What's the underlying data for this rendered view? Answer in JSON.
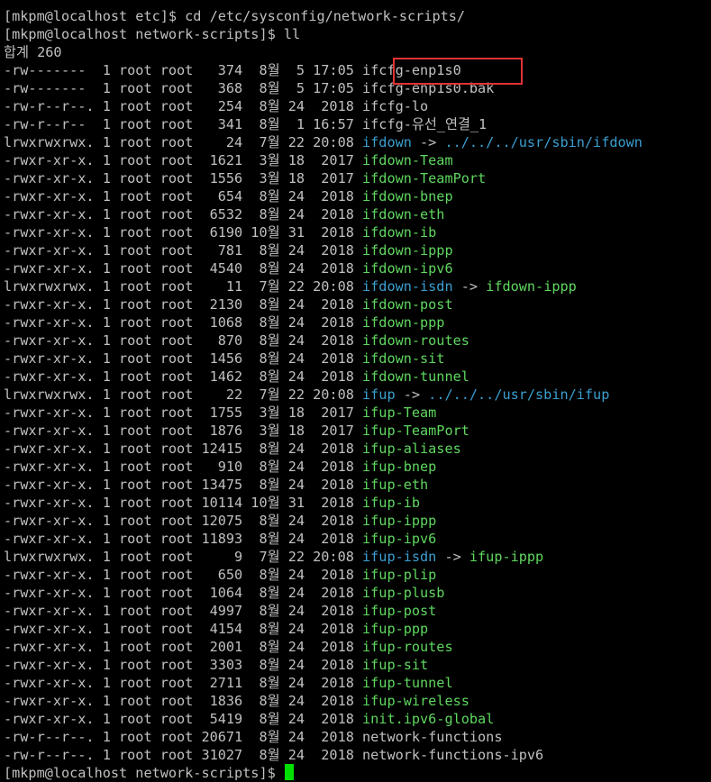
{
  "terminal": {
    "lines": [
      {
        "meta": "[mkpm@localhost etc]$ cd /etc/sysconfig/network-scripts/",
        "name": "",
        "kind": "plain"
      },
      {
        "meta": "[mkpm@localhost network-scripts]$ ll",
        "name": "",
        "kind": "plain"
      },
      {
        "meta": "합계 260",
        "name": "",
        "kind": "plain"
      },
      {
        "meta": "-rw-------  1 root root   374  8월  5 17:05 ",
        "name": "ifcfg-enp1s0",
        "kind": "plain"
      },
      {
        "meta": "-rw-------  1 root root   368  8월  5 17:05 ",
        "name": "ifcfg-enp1s0.bak",
        "kind": "plain"
      },
      {
        "meta": "-rw-r--r--. 1 root root   254  8월 24  2018 ",
        "name": "ifcfg-lo",
        "kind": "plain"
      },
      {
        "meta": "-rw-r--r--  1 root root   341  8월  1 16:57 ",
        "name": "ifcfg-유선_연결_1",
        "kind": "plain"
      },
      {
        "meta": "lrwxrwxrwx. 1 root root    24  7월 22 20:08 ",
        "name": "ifdown",
        "kind": "link",
        "target": "../../../usr/sbin/ifdown"
      },
      {
        "meta": "-rwxr-xr-x. 1 root root  1621  3월 18  2017 ",
        "name": "ifdown-Team",
        "kind": "exec"
      },
      {
        "meta": "-rwxr-xr-x. 1 root root  1556  3월 18  2017 ",
        "name": "ifdown-TeamPort",
        "kind": "exec"
      },
      {
        "meta": "-rwxr-xr-x. 1 root root   654  8월 24  2018 ",
        "name": "ifdown-bnep",
        "kind": "exec"
      },
      {
        "meta": "-rwxr-xr-x. 1 root root  6532  8월 24  2018 ",
        "name": "ifdown-eth",
        "kind": "exec"
      },
      {
        "meta": "-rwxr-xr-x. 1 root root  6190 10월 31  2018 ",
        "name": "ifdown-ib",
        "kind": "exec"
      },
      {
        "meta": "-rwxr-xr-x. 1 root root   781  8월 24  2018 ",
        "name": "ifdown-ippp",
        "kind": "exec"
      },
      {
        "meta": "-rwxr-xr-x. 1 root root  4540  8월 24  2018 ",
        "name": "ifdown-ipv6",
        "kind": "exec"
      },
      {
        "meta": "lrwxrwxrwx. 1 root root    11  7월 22 20:08 ",
        "name": "ifdown-isdn",
        "kind": "link",
        "target": "ifdown-ippp",
        "target_kind": "exec"
      },
      {
        "meta": "-rwxr-xr-x. 1 root root  2130  8월 24  2018 ",
        "name": "ifdown-post",
        "kind": "exec"
      },
      {
        "meta": "-rwxr-xr-x. 1 root root  1068  8월 24  2018 ",
        "name": "ifdown-ppp",
        "kind": "exec"
      },
      {
        "meta": "-rwxr-xr-x. 1 root root   870  8월 24  2018 ",
        "name": "ifdown-routes",
        "kind": "exec"
      },
      {
        "meta": "-rwxr-xr-x. 1 root root  1456  8월 24  2018 ",
        "name": "ifdown-sit",
        "kind": "exec"
      },
      {
        "meta": "-rwxr-xr-x. 1 root root  1462  8월 24  2018 ",
        "name": "ifdown-tunnel",
        "kind": "exec"
      },
      {
        "meta": "lrwxrwxrwx. 1 root root    22  7월 22 20:08 ",
        "name": "ifup",
        "kind": "link",
        "target": "../../../usr/sbin/ifup"
      },
      {
        "meta": "-rwxr-xr-x. 1 root root  1755  3월 18  2017 ",
        "name": "ifup-Team",
        "kind": "exec"
      },
      {
        "meta": "-rwxr-xr-x. 1 root root  1876  3월 18  2017 ",
        "name": "ifup-TeamPort",
        "kind": "exec"
      },
      {
        "meta": "-rwxr-xr-x. 1 root root 12415  8월 24  2018 ",
        "name": "ifup-aliases",
        "kind": "exec"
      },
      {
        "meta": "-rwxr-xr-x. 1 root root   910  8월 24  2018 ",
        "name": "ifup-bnep",
        "kind": "exec"
      },
      {
        "meta": "-rwxr-xr-x. 1 root root 13475  8월 24  2018 ",
        "name": "ifup-eth",
        "kind": "exec"
      },
      {
        "meta": "-rwxr-xr-x. 1 root root 10114 10월 31  2018 ",
        "name": "ifup-ib",
        "kind": "exec"
      },
      {
        "meta": "-rwxr-xr-x. 1 root root 12075  8월 24  2018 ",
        "name": "ifup-ippp",
        "kind": "exec"
      },
      {
        "meta": "-rwxr-xr-x. 1 root root 11893  8월 24  2018 ",
        "name": "ifup-ipv6",
        "kind": "exec"
      },
      {
        "meta": "lrwxrwxrwx. 1 root root     9  7월 22 20:08 ",
        "name": "ifup-isdn",
        "kind": "link",
        "target": "ifup-ippp",
        "target_kind": "exec"
      },
      {
        "meta": "-rwxr-xr-x. 1 root root   650  8월 24  2018 ",
        "name": "ifup-plip",
        "kind": "exec"
      },
      {
        "meta": "-rwxr-xr-x. 1 root root  1064  8월 24  2018 ",
        "name": "ifup-plusb",
        "kind": "exec"
      },
      {
        "meta": "-rwxr-xr-x. 1 root root  4997  8월 24  2018 ",
        "name": "ifup-post",
        "kind": "exec"
      },
      {
        "meta": "-rwxr-xr-x. 1 root root  4154  8월 24  2018 ",
        "name": "ifup-ppp",
        "kind": "exec"
      },
      {
        "meta": "-rwxr-xr-x. 1 root root  2001  8월 24  2018 ",
        "name": "ifup-routes",
        "kind": "exec"
      },
      {
        "meta": "-rwxr-xr-x. 1 root root  3303  8월 24  2018 ",
        "name": "ifup-sit",
        "kind": "exec"
      },
      {
        "meta": "-rwxr-xr-x. 1 root root  2711  8월 24  2018 ",
        "name": "ifup-tunnel",
        "kind": "exec"
      },
      {
        "meta": "-rwxr-xr-x. 1 root root  1836  8월 24  2018 ",
        "name": "ifup-wireless",
        "kind": "exec"
      },
      {
        "meta": "-rwxr-xr-x. 1 root root  5419  8월 24  2018 ",
        "name": "init.ipv6-global",
        "kind": "exec"
      },
      {
        "meta": "-rw-r--r--. 1 root root 20671  8월 24  2018 ",
        "name": "network-functions",
        "kind": "plain"
      },
      {
        "meta": "-rw-r--r--. 1 root root 31027  8월 24  2018 ",
        "name": "network-functions-ipv6",
        "kind": "plain"
      }
    ],
    "prompt": "[mkpm@localhost network-scripts]$ ",
    "link_arrow": " -> "
  },
  "colors": {
    "background": "#000000",
    "text": "#c0c0c0",
    "link": "#3b9fd0",
    "executable": "#5fd75f",
    "highlight_box": "#e23232",
    "cursor": "#00e000"
  }
}
